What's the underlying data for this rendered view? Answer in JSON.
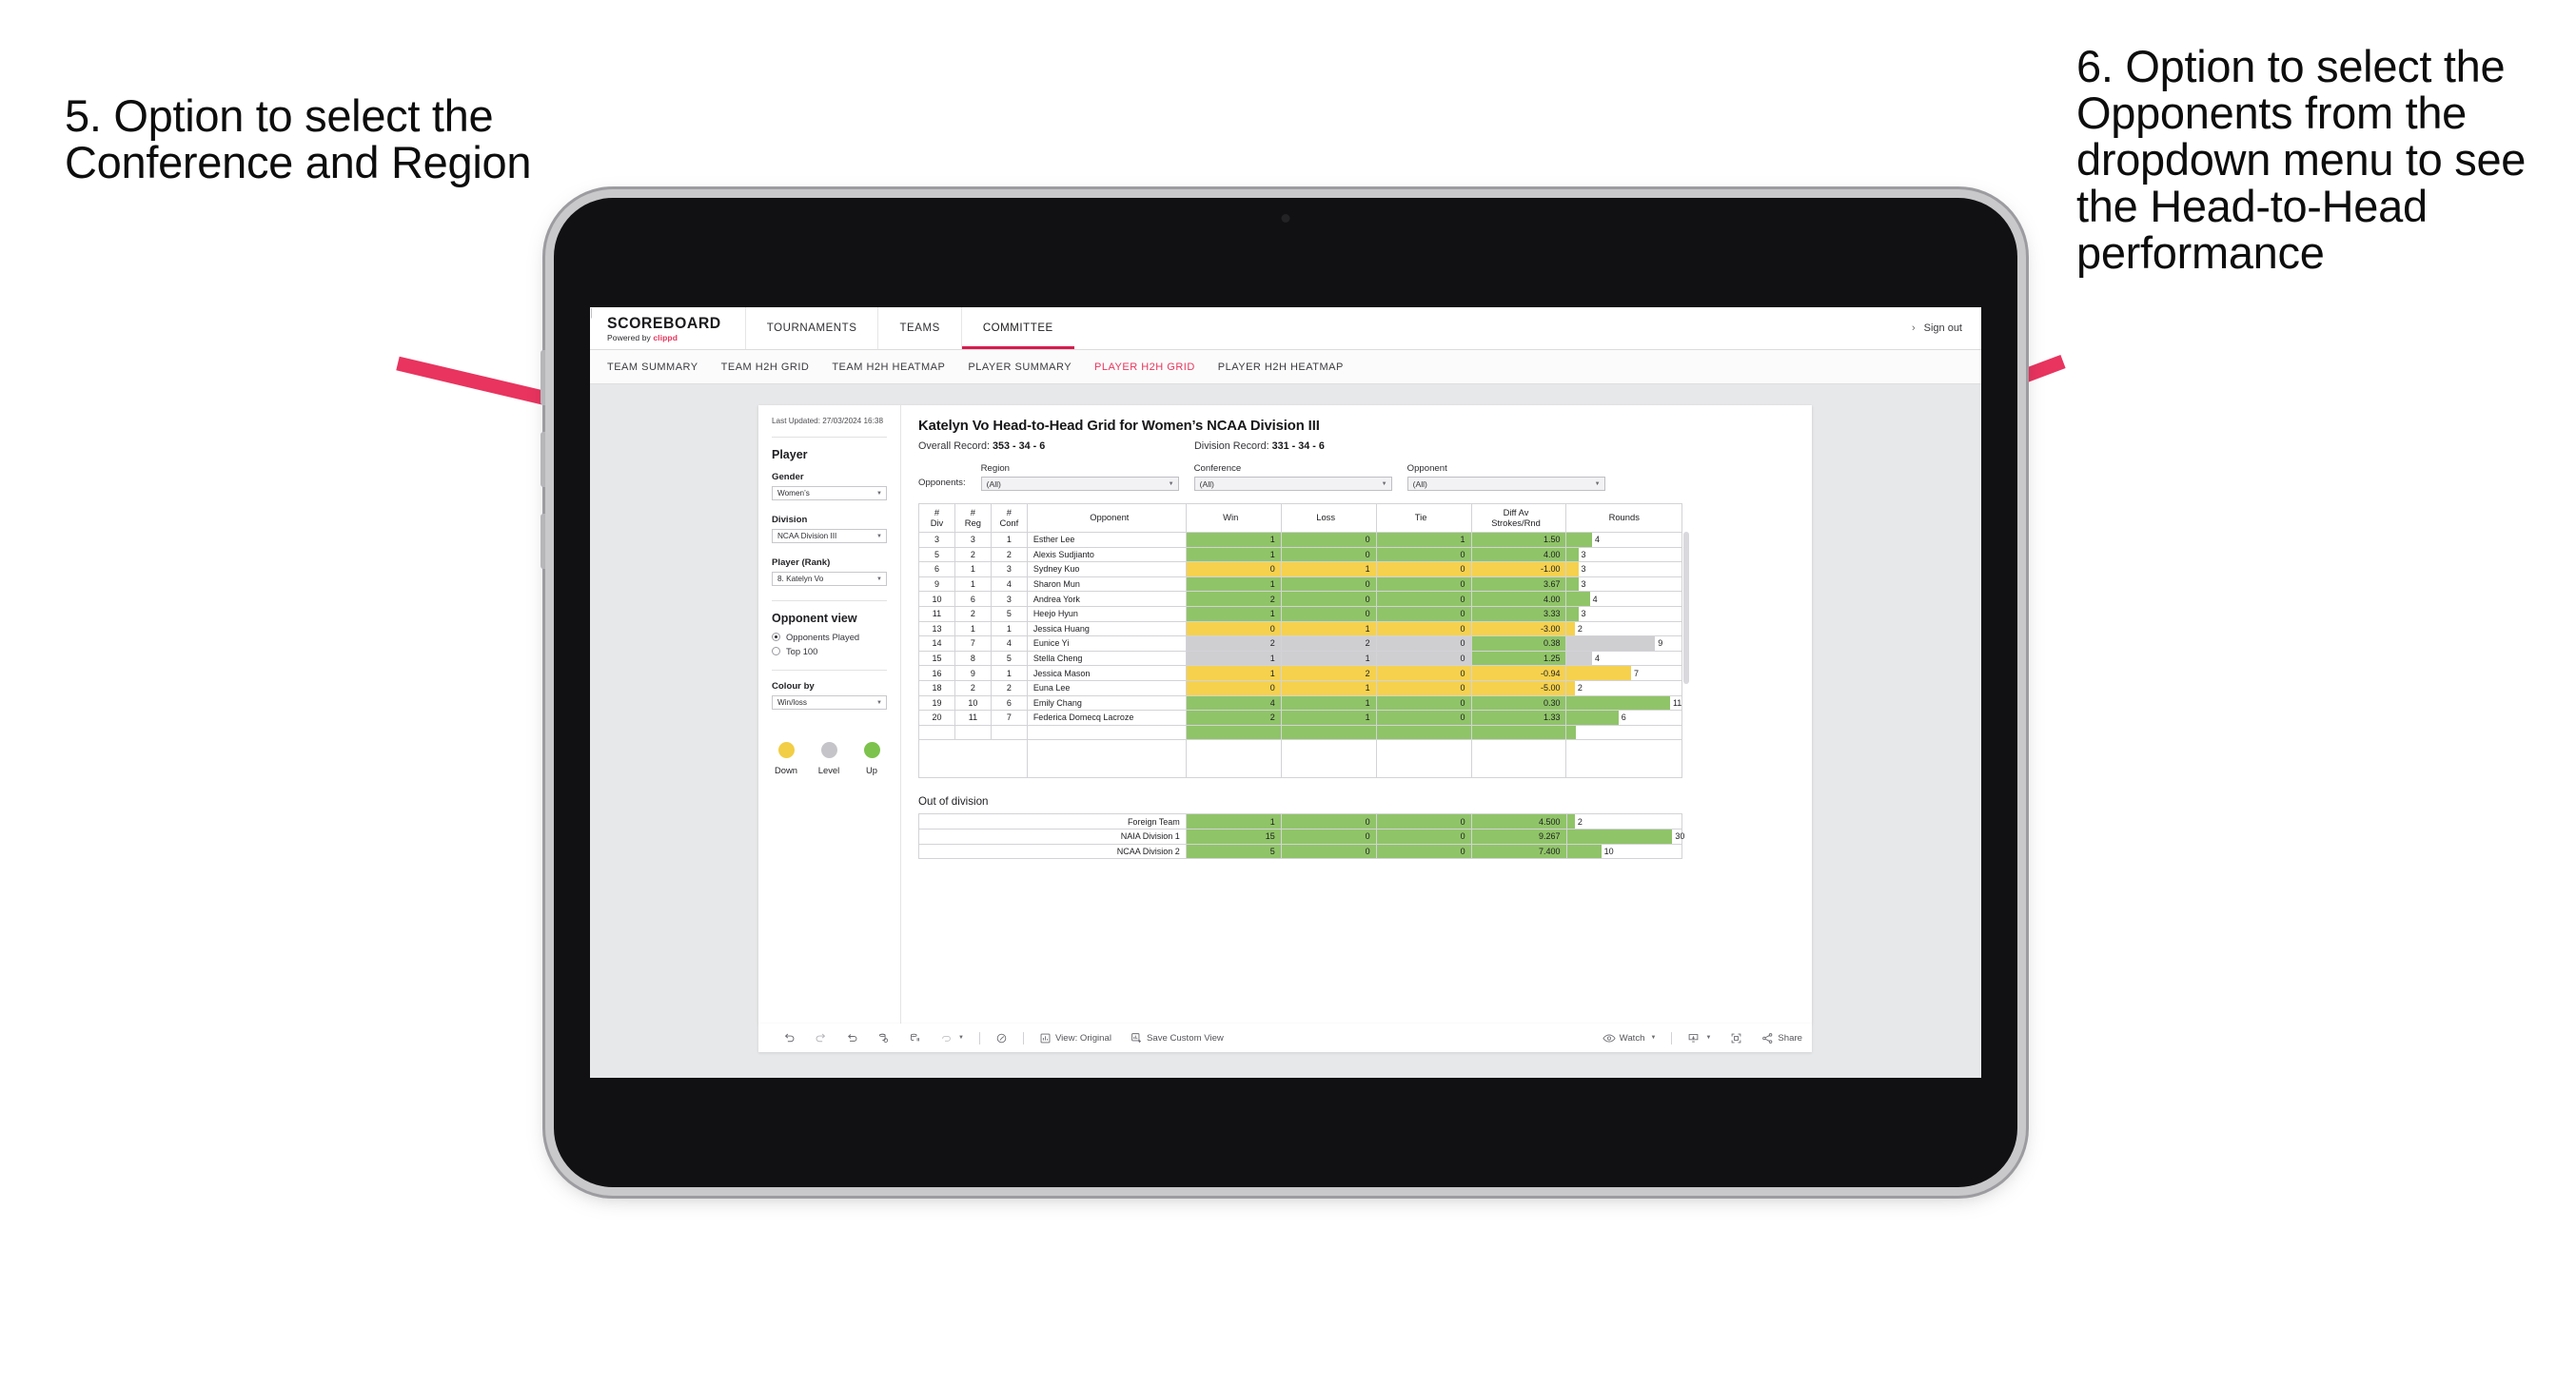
{
  "annotations": {
    "left": "5. Option to select the Conference and Region",
    "right": "6. Option to select the Opponents from the dropdown menu to see the Head-to-Head performance",
    "arrow_color": "#e8345f"
  },
  "header": {
    "brand_name": "SCOREBOARD",
    "brand_powered_prefix": "Powered by ",
    "brand_powered_name": "clippd",
    "nav": [
      {
        "label": "TOURNAMENTS",
        "active": false
      },
      {
        "label": "TEAMS",
        "active": false
      },
      {
        "label": "COMMITTEE",
        "active": true
      }
    ],
    "chevron_icon": "›",
    "divider": "|",
    "sign_out": "Sign out",
    "accent": "#d81b4e"
  },
  "subnav": [
    {
      "label": "TEAM SUMMARY",
      "active": false
    },
    {
      "label": "TEAM H2H GRID",
      "active": false
    },
    {
      "label": "TEAM H2H HEATMAP",
      "active": false
    },
    {
      "label": "PLAYER SUMMARY",
      "active": false
    },
    {
      "label": "PLAYER H2H GRID",
      "active": true
    },
    {
      "label": "PLAYER H2H HEATMAP",
      "active": false
    }
  ],
  "sidebar": {
    "last_updated": "Last Updated: 27/03/2024 16:38",
    "player_heading": "Player",
    "gender_label": "Gender",
    "gender_value": "Women’s",
    "division_label": "Division",
    "division_value": "NCAA Division III",
    "player_rank_label": "Player (Rank)",
    "player_rank_value": "8. Katelyn Vo",
    "opponent_view_heading": "Opponent view",
    "opponent_view_options": [
      {
        "label": "Opponents Played",
        "selected": true
      },
      {
        "label": "Top 100",
        "selected": false
      }
    ],
    "colour_by_label": "Colour by",
    "colour_by_value": "Win/loss",
    "legend": [
      {
        "label": "Down",
        "color": "#f2ce46"
      },
      {
        "label": "Level",
        "color": "#c5c5c9"
      },
      {
        "label": "Up",
        "color": "#7cc24c"
      }
    ]
  },
  "main": {
    "title": "Katelyn Vo Head-to-Head Grid for Women’s NCAA Division III",
    "overall_record_label": "Overall Record: ",
    "overall_record_value": "353 -  34 - 6",
    "division_record_label": "Division Record: ",
    "division_record_value": "331 -  34 - 6",
    "opponents_tag": "Opponents:",
    "filters": [
      {
        "label": "Region",
        "value": "(All)"
      },
      {
        "label": "Conference",
        "value": "(All)"
      },
      {
        "label": "Opponent",
        "value": "(All)"
      }
    ],
    "columns": [
      {
        "l1": "#",
        "l2": "Div"
      },
      {
        "l1": "#",
        "l2": "Reg"
      },
      {
        "l1": "#",
        "l2": "Conf"
      },
      {
        "l1": "Opponent",
        "l2": ""
      },
      {
        "l1": "Win",
        "l2": ""
      },
      {
        "l1": "Loss",
        "l2": ""
      },
      {
        "l1": "Tie",
        "l2": ""
      },
      {
        "l1": "Diff Av",
        "l2": "Strokes/Rnd"
      },
      {
        "l1": "Rounds",
        "l2": ""
      }
    ],
    "rows": [
      {
        "div": "3",
        "reg": "3",
        "conf": "1",
        "opponent": "Esther Lee",
        "win": "1",
        "loss": "0",
        "tie": "1",
        "diff": "1.50",
        "rounds": "4",
        "state": "up",
        "bar_pct": 22
      },
      {
        "div": "5",
        "reg": "2",
        "conf": "2",
        "opponent": "Alexis Sudjianto",
        "win": "1",
        "loss": "0",
        "tie": "0",
        "diff": "4.00",
        "rounds": "3",
        "state": "up",
        "bar_pct": 10
      },
      {
        "div": "6",
        "reg": "1",
        "conf": "3",
        "opponent": "Sydney Kuo",
        "win": "0",
        "loss": "1",
        "tie": "0",
        "diff": "-1.00",
        "rounds": "3",
        "state": "down",
        "bar_pct": 10
      },
      {
        "div": "9",
        "reg": "1",
        "conf": "4",
        "opponent": "Sharon Mun",
        "win": "1",
        "loss": "0",
        "tie": "0",
        "diff": "3.67",
        "rounds": "3",
        "state": "up",
        "bar_pct": 10
      },
      {
        "div": "10",
        "reg": "6",
        "conf": "3",
        "opponent": "Andrea York",
        "win": "2",
        "loss": "0",
        "tie": "0",
        "diff": "4.00",
        "rounds": "4",
        "state": "up",
        "bar_pct": 20
      },
      {
        "div": "11",
        "reg": "2",
        "conf": "5",
        "opponent": "Heejo Hyun",
        "win": "1",
        "loss": "0",
        "tie": "0",
        "diff": "3.33",
        "rounds": "3",
        "state": "up",
        "bar_pct": 10
      },
      {
        "div": "13",
        "reg": "1",
        "conf": "1",
        "opponent": "Jessica Huang",
        "win": "0",
        "loss": "1",
        "tie": "0",
        "diff": "-3.00",
        "rounds": "2",
        "state": "down",
        "bar_pct": 7
      },
      {
        "div": "14",
        "reg": "7",
        "conf": "4",
        "opponent": "Eunice Yi",
        "win": "2",
        "loss": "2",
        "tie": "0",
        "diff": "0.38",
        "rounds": "9",
        "state": "level",
        "bar_pct": 77,
        "diff_state": "up"
      },
      {
        "div": "15",
        "reg": "8",
        "conf": "5",
        "opponent": "Stella Cheng",
        "win": "1",
        "loss": "1",
        "tie": "0",
        "diff": "1.25",
        "rounds": "4",
        "state": "level",
        "bar_pct": 22,
        "diff_state": "up"
      },
      {
        "div": "16",
        "reg": "9",
        "conf": "1",
        "opponent": "Jessica Mason",
        "win": "1",
        "loss": "2",
        "tie": "0",
        "diff": "-0.94",
        "rounds": "7",
        "state": "down",
        "bar_pct": 56
      },
      {
        "div": "18",
        "reg": "2",
        "conf": "2",
        "opponent": "Euna Lee",
        "win": "0",
        "loss": "1",
        "tie": "0",
        "diff": "-5.00",
        "rounds": "2",
        "state": "down",
        "bar_pct": 7
      },
      {
        "div": "19",
        "reg": "10",
        "conf": "6",
        "opponent": "Emily Chang",
        "win": "4",
        "loss": "1",
        "tie": "0",
        "diff": "0.30",
        "rounds": "11",
        "state": "up",
        "bar_pct": 90
      },
      {
        "div": "20",
        "reg": "11",
        "conf": "7",
        "opponent": "Federica Domecq Lacroze",
        "win": "2",
        "loss": "1",
        "tie": "0",
        "diff": "1.33",
        "rounds": "6",
        "state": "up",
        "bar_pct": 45
      }
    ],
    "out_of_division_heading": "Out of division",
    "out_of_division_rows": [
      {
        "label": "Foreign Team",
        "win": "1",
        "loss": "0",
        "tie": "0",
        "diff": "4.500",
        "rounds": "2",
        "state": "up",
        "bar_pct": 7
      },
      {
        "label": "NAIA Division 1",
        "win": "15",
        "loss": "0",
        "tie": "0",
        "diff": "9.267",
        "rounds": "30",
        "state": "up",
        "bar_pct": 92
      },
      {
        "label": "NCAA Division 2",
        "win": "5",
        "loss": "0",
        "tie": "0",
        "diff": "7.400",
        "rounds": "10",
        "state": "up",
        "bar_pct": 30
      }
    ]
  },
  "toolbar": {
    "view_label": "View: Original",
    "save_label": "Save Custom View",
    "watch_label": "Watch",
    "share_label": "Share"
  },
  "colors": {
    "up": "#90c468",
    "down": "#f5d14e",
    "level": "#cfcfd2"
  }
}
